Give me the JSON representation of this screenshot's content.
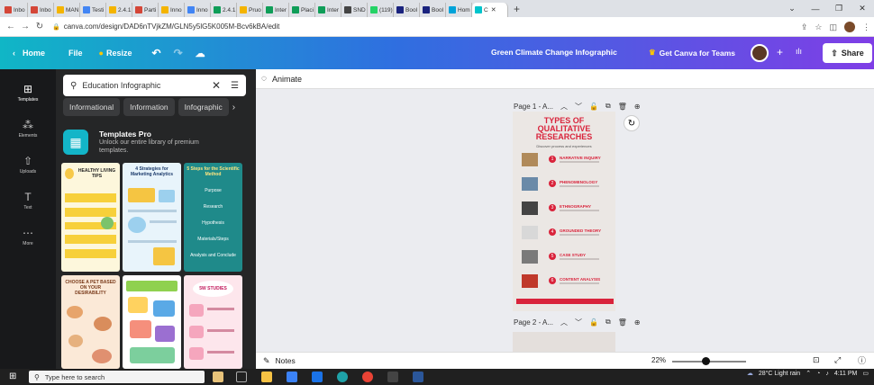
{
  "browser": {
    "tabs": [
      {
        "label": "Inbo",
        "color": "#d44638"
      },
      {
        "label": "Inbo",
        "color": "#d44638"
      },
      {
        "label": "MAN",
        "color": "#f4b400"
      },
      {
        "label": "Testi",
        "color": "#4285f4"
      },
      {
        "label": "2.4.1",
        "color": "#f4b400"
      },
      {
        "label": "Parti",
        "color": "#d44638"
      },
      {
        "label": "Inno",
        "color": "#f4b400"
      },
      {
        "label": "Inno",
        "color": "#4285f4"
      },
      {
        "label": "2.4.1",
        "color": "#0f9d58"
      },
      {
        "label": "Pruo",
        "color": "#f4b400"
      },
      {
        "label": "Inter",
        "color": "#0f9d58"
      },
      {
        "label": "Placi",
        "color": "#0f9d58"
      },
      {
        "label": "Inter",
        "color": "#0f9d58"
      },
      {
        "label": "SND",
        "color": "#444"
      },
      {
        "label": "(119)",
        "color": "#25d366"
      },
      {
        "label": "Bool",
        "color": "#1a237e"
      },
      {
        "label": "Bool",
        "color": "#1a237e"
      },
      {
        "label": "Hom",
        "color": "#00a3d9"
      },
      {
        "label": "C",
        "color": "#00c4cc",
        "active": true
      }
    ],
    "new_tab": "+",
    "url": "canva.com/design/DAD6nTVjkZM/GLN5y5lG5K005M-Bcv6kBA/edit"
  },
  "canva_header": {
    "home": "Home",
    "file": "File",
    "resize": "Resize",
    "doc_title": "Green Climate Change Infographic",
    "get_teams": "Get Canva for Teams",
    "share": "Share"
  },
  "rail": [
    {
      "label": "Templates",
      "icon": "templates-icon",
      "glyph": "⊞"
    },
    {
      "label": "Elements",
      "icon": "elements-icon",
      "glyph": "⁂"
    },
    {
      "label": "Uploads",
      "icon": "uploads-icon",
      "glyph": "⇧"
    },
    {
      "label": "Text",
      "icon": "text-icon",
      "glyph": "T"
    },
    {
      "label": "More",
      "icon": "more-icon",
      "glyph": "⋯"
    }
  ],
  "panel": {
    "search_value": "Education Infographic",
    "chips": [
      "Informational",
      "Information",
      "Infographic"
    ],
    "pro_title": "Templates Pro",
    "pro_desc": "Unlock our entire library of premium templates.",
    "thumbs": [
      {
        "title": "HEALTHY LIVING TIPS"
      },
      {
        "title": "4 Strategies for Marketing Analytics"
      },
      {
        "title": "5 Steps for the Scientific Method"
      },
      {
        "title": "CHOOSE A PET BASED ON YOUR DESIRABILITY"
      },
      {
        "title": ""
      },
      {
        "title": "5W STUDIES"
      }
    ],
    "thumb3_sections": [
      "Purpose",
      "Research",
      "Hypothesis",
      "Materials/Steps",
      "Analysis and Conclude"
    ]
  },
  "workspace": {
    "animate": "Animate",
    "page1_label": "Page 1 - A...",
    "page2_label": "Page 2 - A...",
    "infographic": {
      "title": "TYPES OF QUALITATIVE RESEARCHES",
      "subtitle": "Discover process and experiences",
      "sections": [
        {
          "n": "1",
          "name": "NARRATIVE INQUIRY"
        },
        {
          "n": "2",
          "name": "PHENOMENOLOGY"
        },
        {
          "n": "3",
          "name": "ETHNOGRAPHY"
        },
        {
          "n": "4",
          "name": "GROUNDED THEORY"
        },
        {
          "n": "5",
          "name": "CASE STUDY"
        },
        {
          "n": "6",
          "name": "CONTENT ANALYSIS"
        }
      ]
    },
    "notes": "Notes",
    "zoom": "22%"
  },
  "taskbar": {
    "search_placeholder": "Type here to search",
    "weather": "28°C  Light rain",
    "time": "4:11 PM"
  }
}
